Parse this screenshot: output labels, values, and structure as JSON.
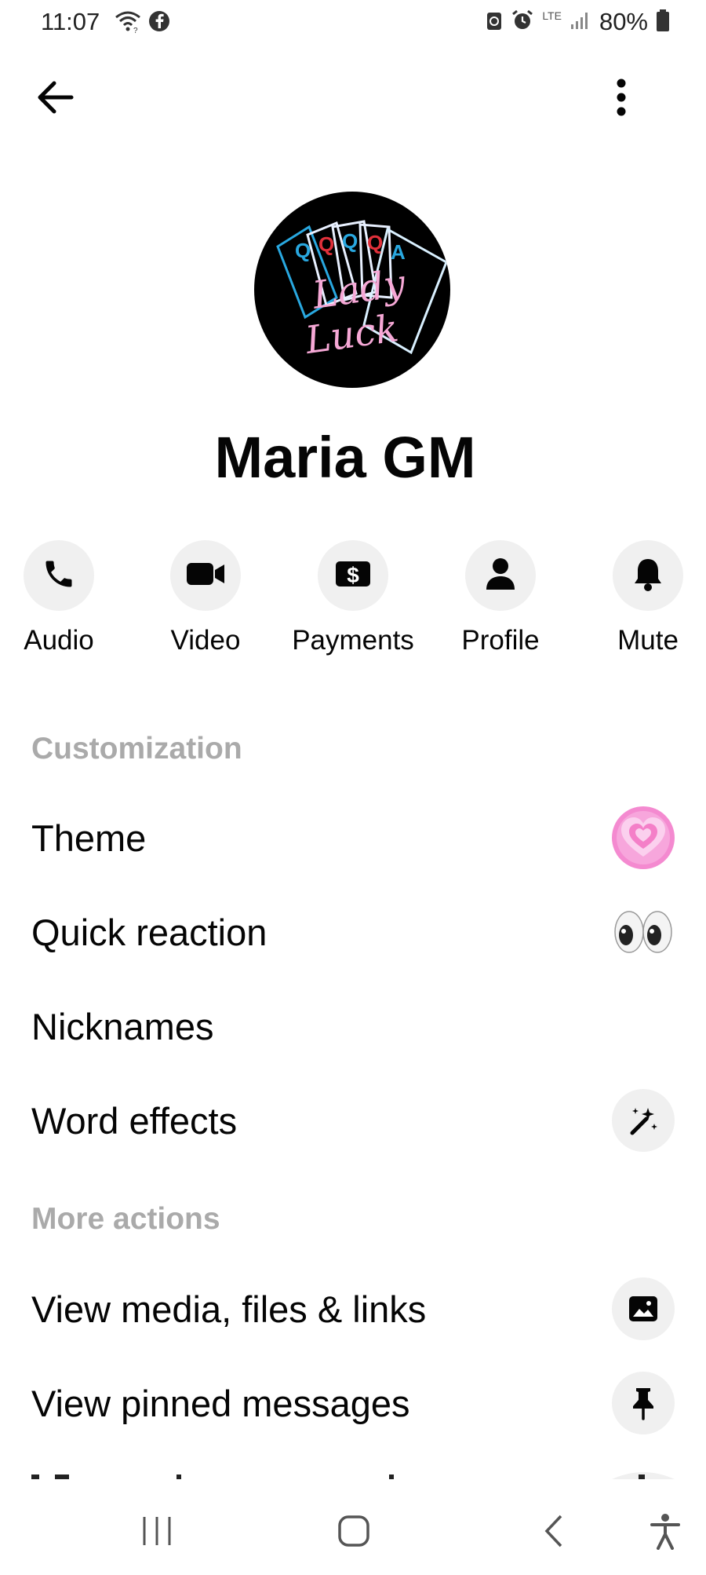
{
  "status_bar": {
    "time": "11:07",
    "network": "LTE",
    "battery": "80%"
  },
  "header": {
    "back_icon": "arrow-left-icon",
    "more_icon": "vertical-dots-icon"
  },
  "profile": {
    "avatar_text_line1": "Lady",
    "avatar_text_line2": "Luck",
    "avatar_cards": [
      "Q",
      "Q",
      "Q",
      "Q",
      "A"
    ],
    "name": "Maria GM"
  },
  "actions": [
    {
      "label": "Audio",
      "icon": "phone-icon"
    },
    {
      "label": "Video",
      "icon": "video-camera-icon"
    },
    {
      "label": "Payments",
      "icon": "dollar-icon"
    },
    {
      "label": "Profile",
      "icon": "person-icon"
    },
    {
      "label": "Mute",
      "icon": "bell-icon"
    }
  ],
  "customization": {
    "header": "Customization",
    "items": [
      {
        "label": "Theme",
        "icon": "heart-theme-icon"
      },
      {
        "label": "Quick reaction",
        "icon": "eyes-emoji-icon"
      },
      {
        "label": "Nicknames",
        "icon": ""
      },
      {
        "label": "Word effects",
        "icon": "magic-wand-icon"
      }
    ]
  },
  "more_actions": {
    "header": "More actions",
    "items": [
      {
        "label": "View media, files & links",
        "icon": "image-icon"
      },
      {
        "label": "View pinned messages",
        "icon": "pin-icon"
      }
    ]
  },
  "colors": {
    "section_header": "#aaaaaa",
    "icon_bg": "#f0f0f0",
    "text": "#050505"
  }
}
